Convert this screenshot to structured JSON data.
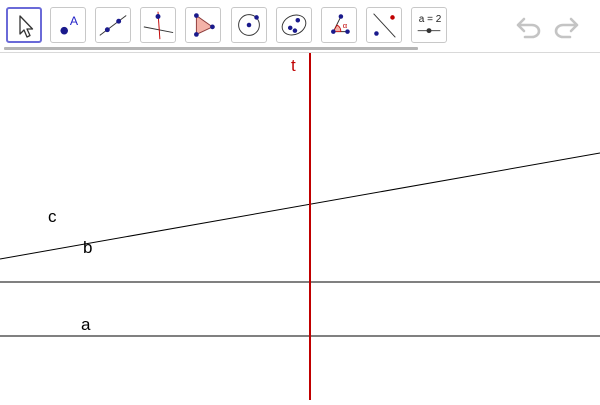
{
  "toolbar": {
    "tools": [
      {
        "id": "move",
        "icon": "move-arrow-icon",
        "selected": true
      },
      {
        "id": "point",
        "icon": "point-icon",
        "label": "A"
      },
      {
        "id": "line",
        "icon": "line-icon"
      },
      {
        "id": "perpendicular",
        "icon": "perpendicular-line-icon"
      },
      {
        "id": "polygon",
        "icon": "polygon-icon"
      },
      {
        "id": "circle",
        "icon": "circle-center-point-icon"
      },
      {
        "id": "ellipse",
        "icon": "ellipse-icon"
      },
      {
        "id": "angle",
        "icon": "angle-icon",
        "label": "α"
      },
      {
        "id": "reflect",
        "icon": "reflect-about-line-icon"
      },
      {
        "id": "slider",
        "icon": "slider-icon",
        "label": "a = 2"
      }
    ],
    "undo_icon": "undo-icon",
    "redo_icon": "redo-icon"
  },
  "colors": {
    "accent": "#6a6ad8",
    "point": "#1a1a8c",
    "line_t": "#c00000",
    "line": "#000000"
  },
  "canvas": {
    "labels": {
      "t": "t",
      "c": "c",
      "b": "b",
      "a": "a"
    }
  }
}
